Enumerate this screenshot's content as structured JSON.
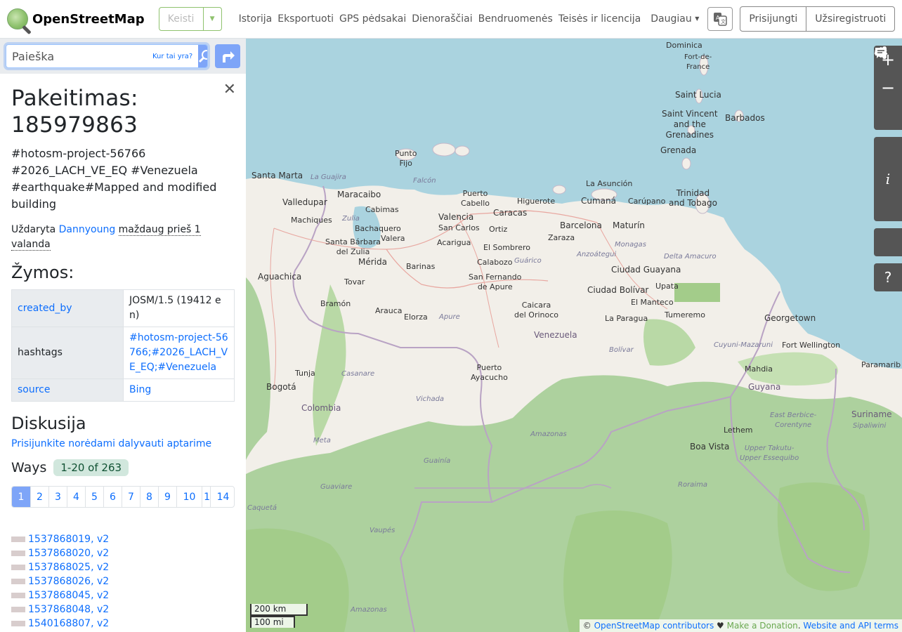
{
  "header": {
    "brand": "OpenStreetMap",
    "edit_label": "Keisti",
    "nav": [
      "Istorija",
      "Eksportuoti",
      "GPS pėdsakai",
      "Dienoraščiai",
      "Bendruomenės",
      "Teisės ir licencija"
    ],
    "more": "Daugiau",
    "login": "Prisijungti",
    "signup": "Užsiregistruoti"
  },
  "search": {
    "placeholder": "Paieška",
    "where": "Kur tai yra?"
  },
  "changeset": {
    "title": "Pakeitimas: 185979863",
    "comment": "#hotosm-project-56766 #2026_LACH_VE_EQ #Venezuela #earthquake#Mapped and modified building",
    "closed_prefix": "Uždaryta",
    "user": "Dannyoung",
    "time": "maždaug prieš 1 valanda",
    "tags_title": "Žymos:",
    "tags": [
      {
        "key": "created_by",
        "value": "JOSM/1.5 (19412 en)"
      },
      {
        "key": "hashtags",
        "value": "#hotosm-project-56766;#2026_LACH_VE_EQ;#Venezuela"
      },
      {
        "key": "source",
        "value": "Bing"
      }
    ],
    "discussion_title": "Diskusija",
    "discussion_link": "Prisijunkite norėdami dalyvauti aptarime",
    "ways_title": "Ways",
    "ways_range": "1-20 of 263",
    "pages": [
      "1",
      "2",
      "3",
      "4",
      "5",
      "6",
      "7",
      "8",
      "9",
      "10",
      "1",
      "14"
    ],
    "ways": [
      "1537868019, v2",
      "1537868020, v2",
      "1537868025, v2",
      "1537868026, v2",
      "1537868045, v2",
      "1537868048, v2",
      "1540168807, v2"
    ]
  },
  "map": {
    "labels": {
      "dominica": "Dominica",
      "fortdefrance": "Fort-de-\nFrance",
      "stlucia": "Saint Lucia",
      "stvincent": "Saint Vincent\nand the\nGrenadines",
      "barbados": "Barbados",
      "grenada": "Grenada",
      "puntofijo": "Punto\nFijo",
      "santamarta": "Santa Marta",
      "laguajira": "La Guajira",
      "falcon": "Falcón",
      "maracaibo": "Maracaibo",
      "cabimas": "Cabimas",
      "zulia": "Zulia",
      "puertocabello": "Puerto\nCabello",
      "higuerote": "Higuerote",
      "caracas": "Caracas",
      "valencia": "Valencia",
      "sancarlos": "San Carlos",
      "laasuncion": "La Asunción",
      "cumana": "Cumaná",
      "carupano": "Carúpano",
      "trinidad": "Trinidad\nand Tobago",
      "valledupar": "Valledupar",
      "machiques": "Machiques",
      "bachaquero": "Bachaquero",
      "santabarbara": "Santa Bárbara\ndel Zulia",
      "valera": "Valera",
      "merida": "Mérida",
      "acarigua": "Acarigua",
      "ortiz": "Ortiz",
      "barcelona": "Barcelona",
      "maturin": "Maturín",
      "elsombrero": "El Sombrero",
      "zaraza": "Zaraza",
      "monagas": "Monagas",
      "anzoategui": "Anzoátegui",
      "deltaamacuro": "Delta Amacuro",
      "ciudadguayana": "Ciudad Guayana",
      "ciudadbolivar": "Ciudad Bolívar",
      "upata": "Upata",
      "barinas": "Barinas",
      "aguachica": "Aguachica",
      "calabozo": "Calabozo",
      "guarico": "Guárico",
      "sanfernando": "San Fernando\nde Apure",
      "tovar": "Tovar",
      "elmanteco": "El Manteco",
      "tumeremo": "Tumeremo",
      "caicara": "Caicara\ndel Orinoco",
      "lapargua": "La Paragua",
      "georgetown": "Georgetown",
      "bramon": "Bramón",
      "arauca": "Arauca",
      "elorza": "Elorza",
      "apure": "Apure",
      "venezuela": "Venezuela",
      "fortwellington": "Fort Wellington",
      "bolivar": "Bolívar",
      "cuyuni": "Cuyuni-Mazaruni",
      "mahdia": "Mahdia",
      "paramaribo": "Paramarib",
      "tunja": "Tunja",
      "casanare": "Casanare",
      "puertoayacucho": "Puerto\nAyacucho",
      "guyana": "Guyana",
      "bogota": "Bogotá",
      "colombia": "Colombia",
      "vichada": "Vichada",
      "suriname": "Suriname",
      "sipaliwini": "Sipaliwini",
      "eastberbice": "East Berbice-\nCorentyne",
      "lethem": "Lethem",
      "amazonas": "Amazonas",
      "boavista": "Boa Vista",
      "upper": "Upper Takutu-\nUpper Essequibo",
      "meta": "Meta",
      "guainia": "Guainía",
      "guaviare": "Guaviare",
      "roraima": "Roraima",
      "caqueta": "Caquetá",
      "vaupes": "Vaupés",
      "amazonas2": "Amazonas"
    },
    "scale_km": "200 km",
    "scale_mi": "100 mi",
    "attribution": {
      "contributors": "OpenStreetMap contributors",
      "heart": "♥",
      "donation": "Make a Donation",
      "terms": "Website and API terms"
    }
  },
  "colors": {
    "water": "#aad3df",
    "land": "#f2efe9",
    "forest": "#a3cc8a",
    "accent": "#0d6efd"
  }
}
